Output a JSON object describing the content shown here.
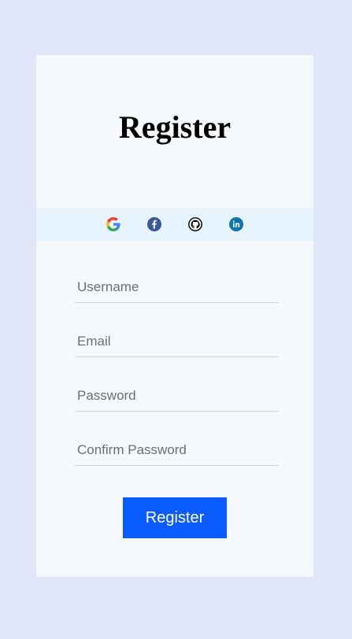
{
  "form": {
    "title": "Register",
    "social": [
      {
        "name": "google",
        "icon": "google-icon"
      },
      {
        "name": "facebook",
        "icon": "facebook-icon",
        "color": "#3b5998"
      },
      {
        "name": "github",
        "icon": "github-icon",
        "color": "#000000"
      },
      {
        "name": "linkedin",
        "icon": "linkedin-icon",
        "color": "#0e76a8"
      }
    ],
    "fields": {
      "username": {
        "placeholder": "Username",
        "value": ""
      },
      "email": {
        "placeholder": "Email",
        "value": ""
      },
      "password": {
        "placeholder": "Password",
        "value": ""
      },
      "confirm_password": {
        "placeholder": "Confirm Password",
        "value": ""
      }
    },
    "submit_label": "Register"
  },
  "colors": {
    "page_background": "#e0e6f8",
    "card_background": "#f6f9fc",
    "social_bar_background": "#e8f4fd",
    "accent": "#0a5cff"
  }
}
